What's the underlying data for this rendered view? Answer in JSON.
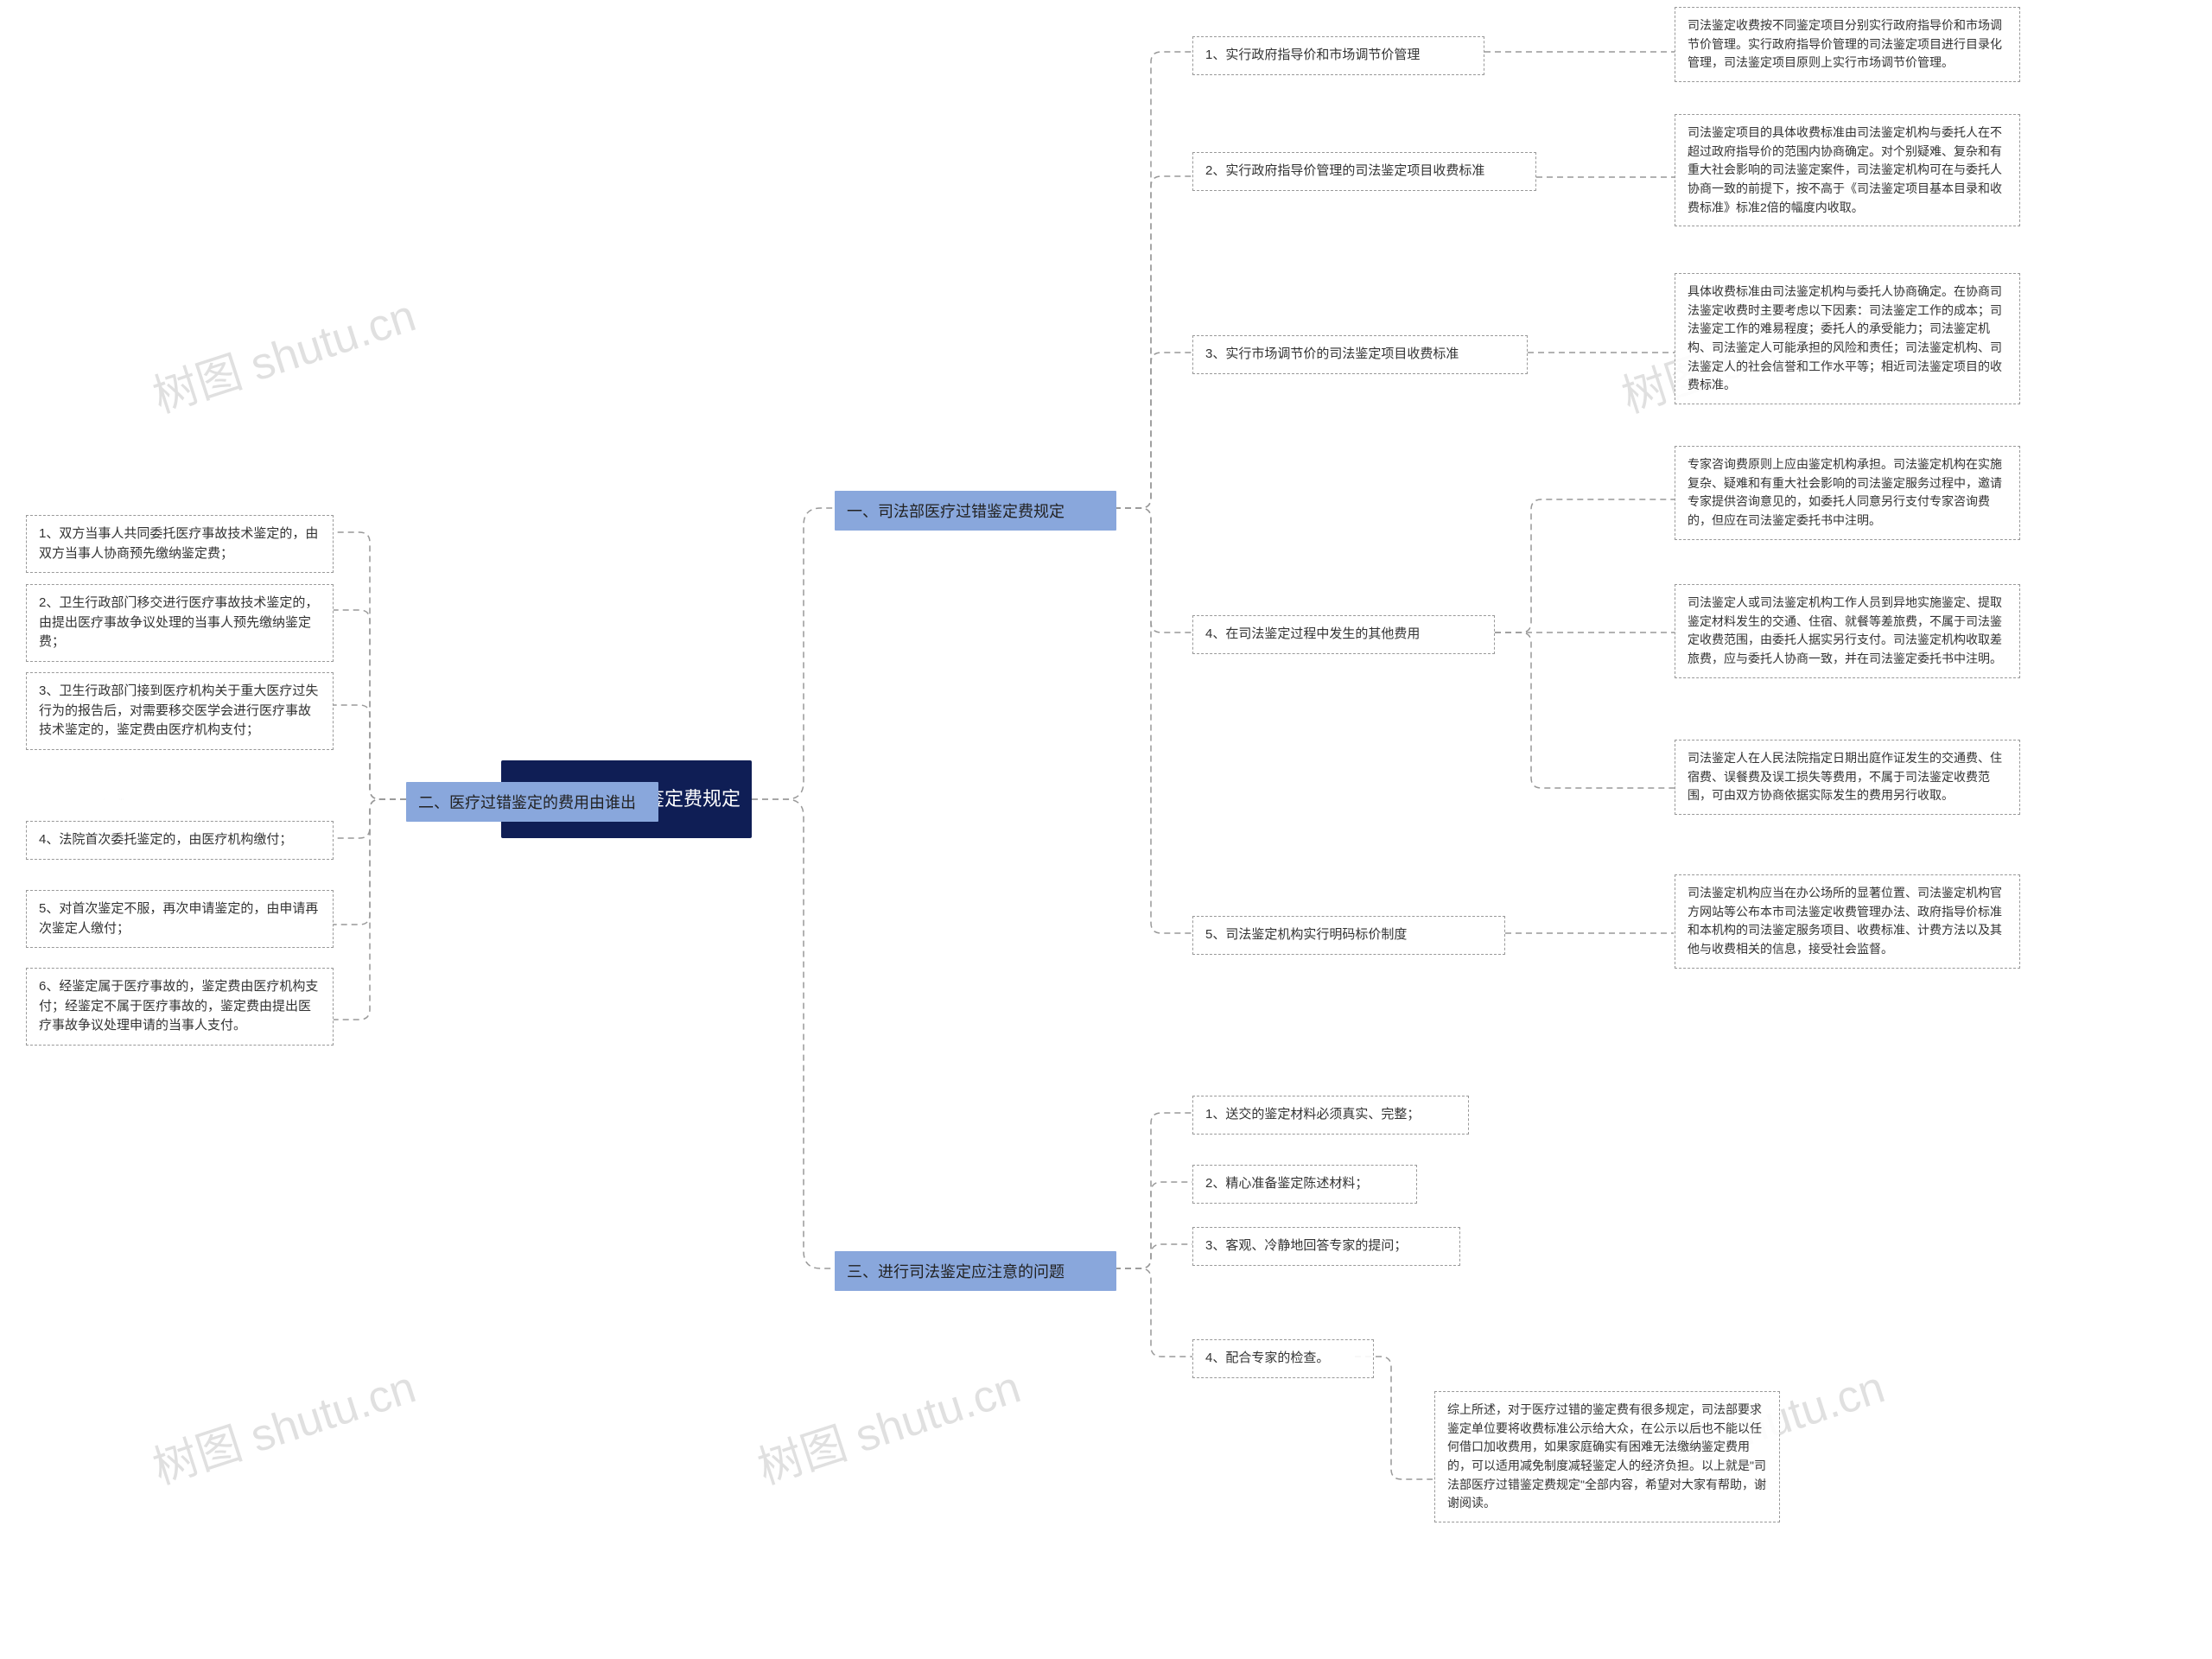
{
  "watermark": "树图 shutu.cn",
  "center": {
    "title": "司法部医疗过错鉴定费规定"
  },
  "branch1": {
    "title": "一、司法部医疗过错鉴定费规定",
    "subs": [
      {
        "label": "1、实行政府指导价和市场调节价管理",
        "detail": "司法鉴定收费按不同鉴定项目分别实行政府指导价和市场调节价管理。实行政府指导价管理的司法鉴定项目进行目录化管理，司法鉴定项目原则上实行市场调节价管理。"
      },
      {
        "label": "2、实行政府指导价管理的司法鉴定项目收费标准",
        "detail": "司法鉴定项目的具体收费标准由司法鉴定机构与委托人在不超过政府指导价的范围内协商确定。对个别疑难、复杂和有重大社会影响的司法鉴定案件，司法鉴定机构可在与委托人协商一致的前提下，按不高于《司法鉴定项目基本目录和收费标准》标准2倍的幅度内收取。"
      },
      {
        "label": "3、实行市场调节价的司法鉴定项目收费标准",
        "detail": "具体收费标准由司法鉴定机构与委托人协商确定。在协商司法鉴定收费时主要考虑以下因素：司法鉴定工作的成本；司法鉴定工作的难易程度；委托人的承受能力；司法鉴定机构、司法鉴定人可能承担的风险和责任；司法鉴定机构、司法鉴定人的社会信誉和工作水平等；相近司法鉴定项目的收费标准。"
      },
      {
        "label": "4、在司法鉴定过程中发生的其他费用",
        "details": [
          "专家咨询费原则上应由鉴定机构承担。司法鉴定机构在实施复杂、疑难和有重大社会影响的司法鉴定服务过程中，邀请专家提供咨询意见的，如委托人同意另行支付专家咨询费的，但应在司法鉴定委托书中注明。",
          "司法鉴定人或司法鉴定机构工作人员到异地实施鉴定、提取鉴定材料发生的交通、住宿、就餐等差旅费，不属于司法鉴定收费范围，由委托人据实另行支付。司法鉴定机构收取差旅费，应与委托人协商一致，并在司法鉴定委托书中注明。",
          "司法鉴定人在人民法院指定日期出庭作证发生的交通费、住宿费、误餐费及误工损失等费用，不属于司法鉴定收费范围，可由双方协商依据实际发生的费用另行收取。"
        ]
      },
      {
        "label": "5、司法鉴定机构实行明码标价制度",
        "detail": "司法鉴定机构应当在办公场所的显著位置、司法鉴定机构官方网站等公布本市司法鉴定收费管理办法、政府指导价标准和本机构的司法鉴定服务项目、收费标准、计费方法以及其他与收费相关的信息，接受社会监督。"
      }
    ]
  },
  "branch2": {
    "title": "二、医疗过错鉴定的费用由谁出",
    "items": [
      "1、双方当事人共同委托医疗事故技术鉴定的，由双方当事人协商预先缴纳鉴定费；",
      "2、卫生行政部门移交进行医疗事故技术鉴定的，由提出医疗事故争议处理的当事人预先缴纳鉴定费；",
      "3、卫生行政部门接到医疗机构关于重大医疗过失行为的报告后，对需要移交医学会进行医疗事故技术鉴定的，鉴定费由医疗机构支付；",
      "4、法院首次委托鉴定的，由医疗机构缴付；",
      "5、对首次鉴定不服，再次申请鉴定的，由申请再次鉴定人缴付；",
      "6、经鉴定属于医疗事故的，鉴定费由医疗机构支付；经鉴定不属于医疗事故的，鉴定费由提出医疗事故争议处理申请的当事人支付。"
    ]
  },
  "branch3": {
    "title": "三、进行司法鉴定应注意的问题",
    "items": [
      "1、送交的鉴定材料必须真实、完整；",
      "2、精心准备鉴定陈述材料；",
      "3、客观、冷静地回答专家的提问；",
      "4、配合专家的检查。"
    ],
    "tail": "综上所述，对于医疗过错的鉴定费有很多规定，司法部要求鉴定单位要将收费标准公示给大众，在公示以后也不能以任何借口加收费用，如果家庭确实有困难无法缴纳鉴定费用的，可以适用减免制度减轻鉴定人的经济负担。以上就是\"司法部医疗过错鉴定费规定\"全部内容，希望对大家有帮助，谢谢阅读。"
  }
}
